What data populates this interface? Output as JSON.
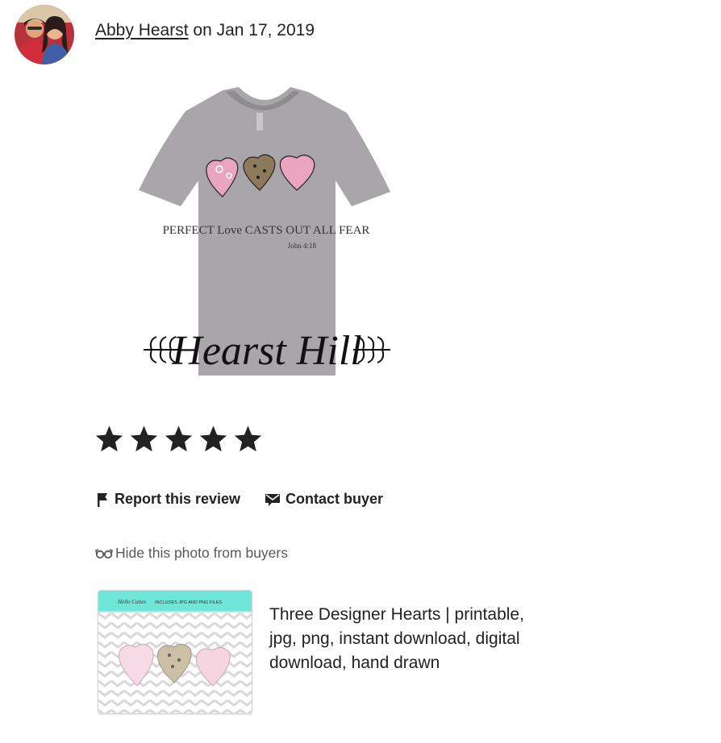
{
  "review": {
    "author": "Abby Hearst",
    "date_text": " on Jan 17, 2019",
    "photo": {
      "print_text": "PERFECT Love CASTS OUT ALL FEAR",
      "verse": "John 4:18",
      "watermark": "Hearst Hill"
    },
    "rating": 5,
    "report_label": "Report this review",
    "contact_label": "Contact buyer",
    "hide_photo_label": "Hide this photo from buyers"
  },
  "listing": {
    "title": "Three Designer Hearts | printable, jpg, png, instant download, digital download, hand drawn",
    "thumb_logo": "Hello Cuties",
    "thumb_banner": "INCLUDES JPG AND PNG FILES"
  },
  "colors": {
    "text": "#222222",
    "muted": "#595959",
    "shirt": "#a8a5a8",
    "teal_banner": "#6ee6d8",
    "heart_pink": "#e8a5bd"
  },
  "icons": [
    "flag-icon",
    "envelope-icon",
    "glasses-icon",
    "star-icon"
  ]
}
